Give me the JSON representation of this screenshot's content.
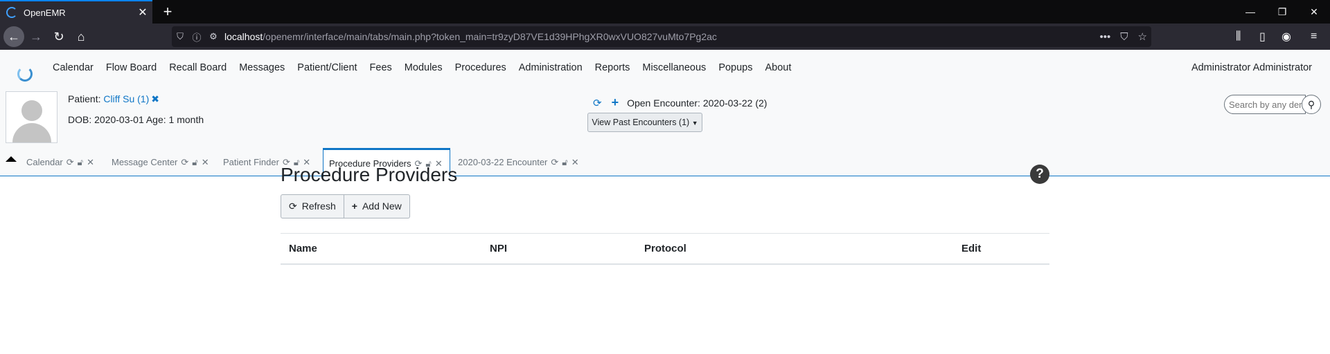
{
  "browser": {
    "tab_title": "OpenEMR",
    "url_host": "localhost",
    "url_path": "/openemr/interface/main/tabs/main.php?token_main=tr9zyD87VE1d39HPhgXR0wxVUO827vuMto7Pg2ac"
  },
  "menu": {
    "items": [
      "Calendar",
      "Flow Board",
      "Recall Board",
      "Messages",
      "Patient/Client",
      "Fees",
      "Modules",
      "Procedures",
      "Administration",
      "Reports",
      "Miscellaneous",
      "Popups",
      "About"
    ],
    "user": "Administrator Administrator"
  },
  "patient": {
    "label": "Patient:",
    "name": "Cliff Su (1)",
    "dob_line": "DOB: 2020-03-01 Age: 1 month"
  },
  "encounter": {
    "open_label": "Open Encounter: 2020-03-22 (2)",
    "past_button": "View Past Encounters  (1)"
  },
  "search": {
    "placeholder": "Search by any demographics"
  },
  "tabs": [
    {
      "label": "Calendar",
      "active": false
    },
    {
      "label": "Message Center",
      "active": false
    },
    {
      "label": "Patient Finder",
      "active": false
    },
    {
      "label": "Procedure Providers",
      "active": true
    },
    {
      "label": "2020-03-22 Encounter",
      "active": false
    }
  ],
  "content": {
    "title": "Procedure Providers",
    "refresh_label": "Refresh",
    "add_new_label": "Add New",
    "columns": [
      "Name",
      "NPI",
      "Protocol",
      "Edit"
    ]
  },
  "icons": {
    "refresh": "refresh-icon",
    "unlock": "unlock-icon",
    "close": "close-icon",
    "help": "help-icon",
    "search": "search-icon",
    "plus": "plus-icon"
  },
  "colors": {
    "accent": "#0f76c6",
    "menubar_bg": "#f8f9fa"
  }
}
